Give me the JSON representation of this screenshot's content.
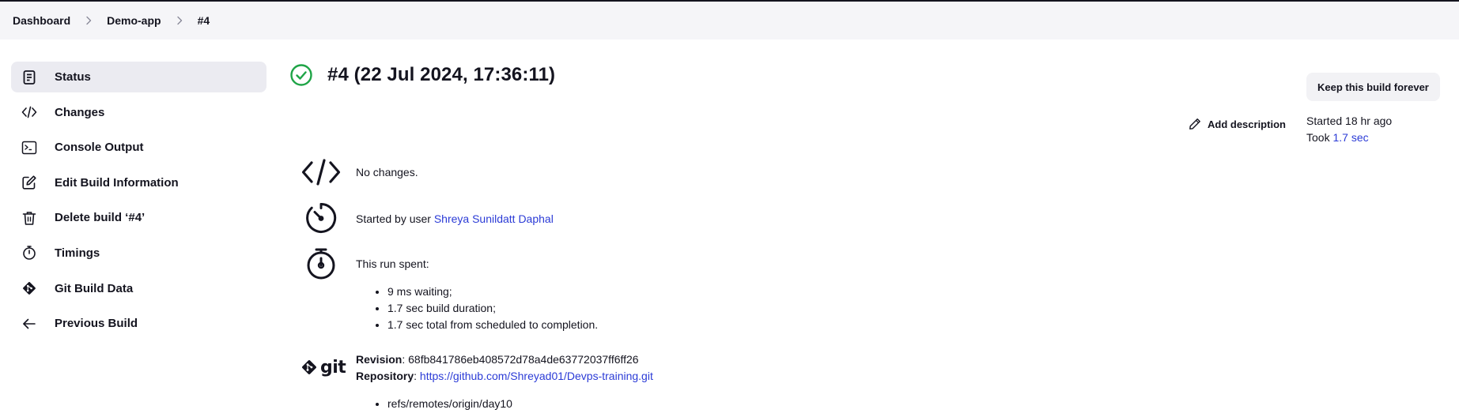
{
  "breadcrumb": {
    "items": [
      "Dashboard",
      "Demo-app",
      "#4"
    ]
  },
  "sidebar": {
    "items": [
      {
        "label": "Status",
        "icon": "status-document-icon",
        "active": true
      },
      {
        "label": "Changes",
        "icon": "code-icon"
      },
      {
        "label": "Console Output",
        "icon": "terminal-icon"
      },
      {
        "label": "Edit Build Information",
        "icon": "edit-icon"
      },
      {
        "label": "Delete build ‘#4’",
        "icon": "trash-icon"
      },
      {
        "label": "Timings",
        "icon": "stopwatch-icon"
      },
      {
        "label": "Git Build Data",
        "icon": "git-icon"
      },
      {
        "label": "Previous Build",
        "icon": "arrow-left-icon"
      }
    ]
  },
  "build": {
    "title": "#4 (22 Jul 2024, 17:36:11)",
    "status_icon": "success-check-icon",
    "status_color": "#1ea446",
    "keep_label": "Keep this build forever",
    "add_description": "Add description",
    "started": "Started 18 hr ago",
    "took_prefix": "Took ",
    "took_value": "1.7 sec"
  },
  "summary": {
    "changes_text": "No changes.",
    "started_by_prefix": "Started by user ",
    "started_by_user": "Shreya Sunildatt Daphal",
    "run_spent_label": "This run spent:",
    "run_spent_items": [
      "9 ms waiting;",
      "1.7 sec build duration;",
      "1.7 sec total from scheduled to completion."
    ],
    "git_logo_text": "git",
    "revision_label": "Revision",
    "revision_value": ": 68fb841786eb408572d78a4de63772037ff6ff26",
    "repository_label": "Repository",
    "repository_sep": ": ",
    "repository_url": "https://github.com/Shreyad01/Devps-training.git",
    "refs": [
      "refs/remotes/origin/day10"
    ]
  },
  "colors": {
    "link": "#2b3bd6",
    "active_sidebar_bg": "#ebebf1",
    "topbar_bg": "#f5f5f8"
  }
}
